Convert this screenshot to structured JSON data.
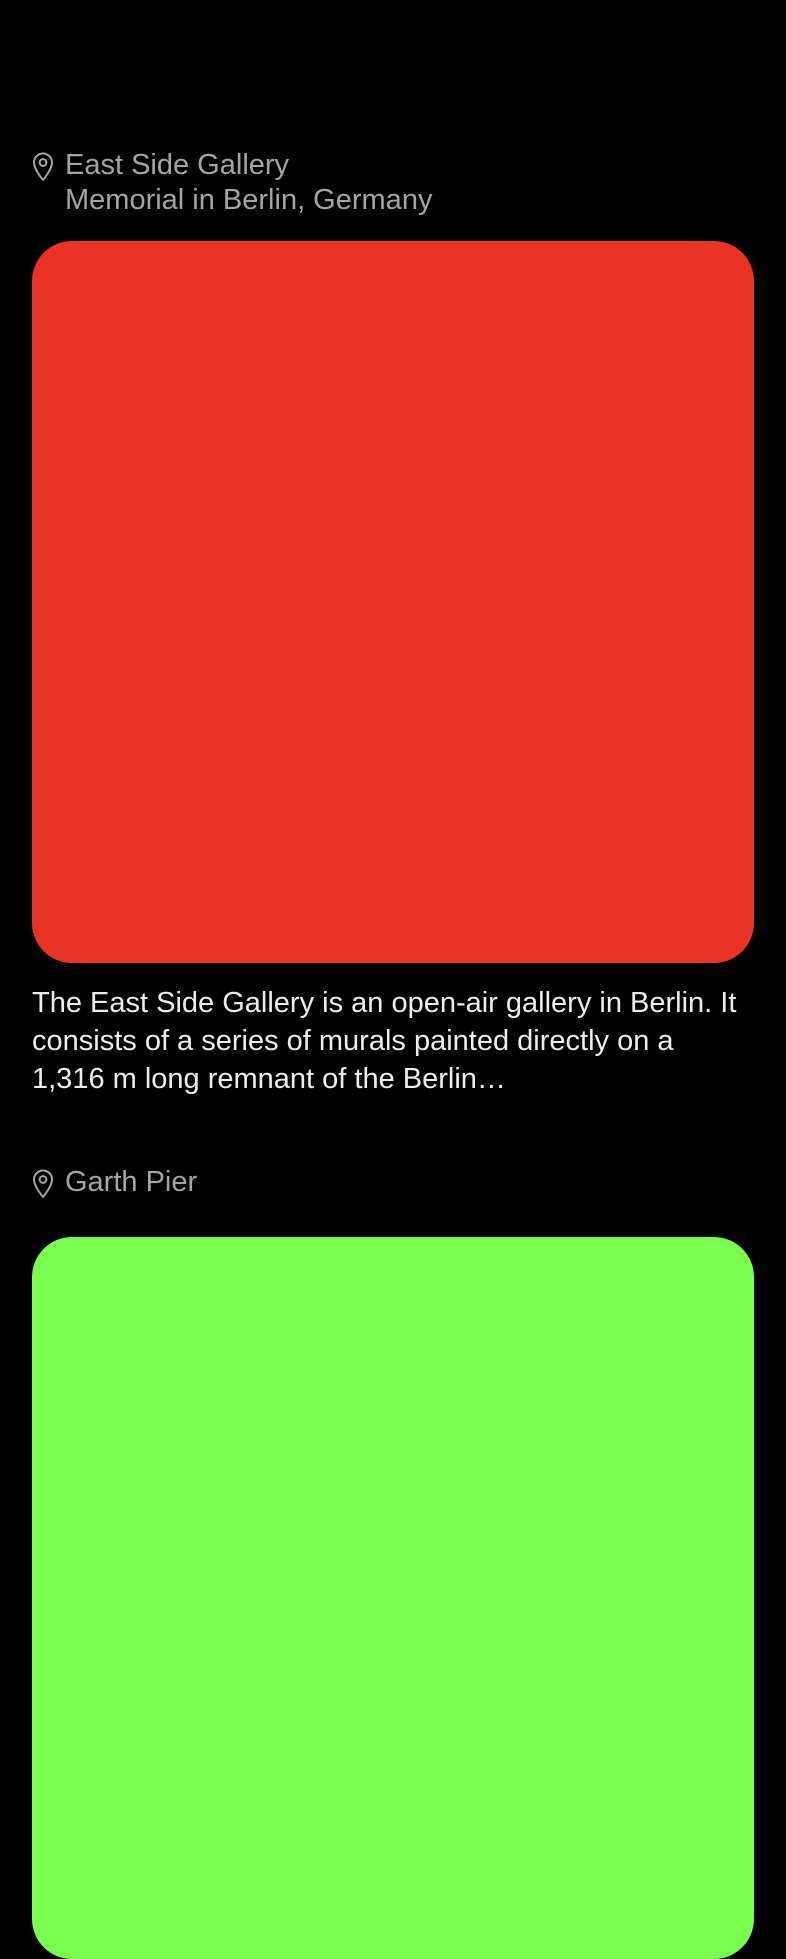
{
  "colors": {
    "background": "#000000",
    "secondary_text": "#a3a3a8",
    "body_text": "#ededf0"
  },
  "cards": [
    {
      "icon": "map-pin-icon",
      "title": "East Side Gallery",
      "subtitle": "Memorial in Berlin, Germany",
      "image_color": "#e93425",
      "description": "The East Side Gallery is an open-air gallery in Berlin. It consists of a series of murals painted directly on a 1,316 m long remnant of the Berlin…"
    },
    {
      "icon": "map-pin-icon",
      "title": "Garth Pier",
      "image_color": "#79fd4e"
    }
  ]
}
